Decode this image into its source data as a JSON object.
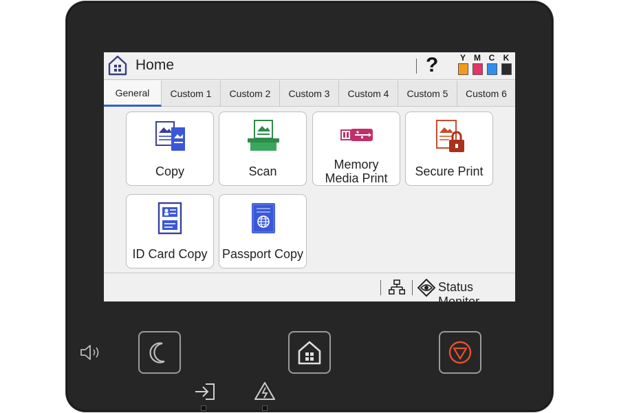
{
  "header": {
    "title": "Home",
    "help_label": "?",
    "home_icon": "home-icon",
    "inks": [
      {
        "label": "Y",
        "color": "#f49b1e"
      },
      {
        "label": "M",
        "color": "#e8326a"
      },
      {
        "label": "C",
        "color": "#2f8ff0"
      },
      {
        "label": "K",
        "color": "#2b2b2b"
      }
    ]
  },
  "tabs": [
    {
      "label": "General",
      "active": true
    },
    {
      "label": "Custom 1",
      "active": false
    },
    {
      "label": "Custom 2",
      "active": false
    },
    {
      "label": "Custom 3",
      "active": false
    },
    {
      "label": "Custom 4",
      "active": false
    },
    {
      "label": "Custom 5",
      "active": false
    },
    {
      "label": "Custom 6",
      "active": false
    }
  ],
  "tiles": [
    {
      "label": "Copy",
      "icon": "copy-icon"
    },
    {
      "label": "Scan",
      "icon": "scan-icon"
    },
    {
      "label_line1": "Memory",
      "label_line2": "Media Print",
      "icon": "memory-media-icon"
    },
    {
      "label": "Secure Print",
      "icon": "secure-print-icon"
    },
    {
      "label": "ID Card Copy",
      "icon": "id-card-icon"
    },
    {
      "label": "Passport Copy",
      "icon": "passport-icon"
    }
  ],
  "footer": {
    "network_icon": "network-icon",
    "status_label": "Status Monitor"
  },
  "hardware": {
    "sleep_icon": "moon-icon",
    "home_icon": "home-icon",
    "stop_icon": "stop-icon",
    "sound_icon": "speaker-icon",
    "data_icon": "data-arrow-icon",
    "error_icon": "warning-icon",
    "stop_color": "#e8502e"
  },
  "colors": {
    "accent": "#2e62c9",
    "screen_bg": "#f0f0f0",
    "device_bg": "#262626"
  }
}
